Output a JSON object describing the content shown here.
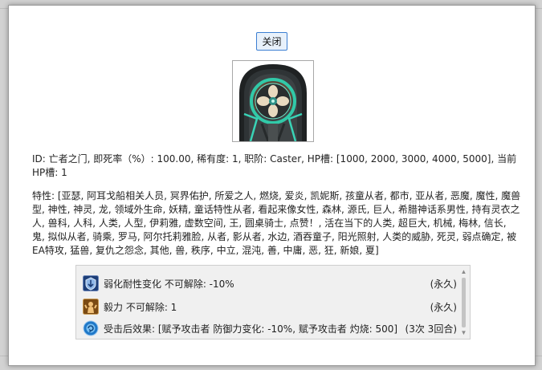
{
  "dialog": {
    "close_label": "关闭",
    "info": "ID: 亡者之门, 即死率（%）: 100.00, 稀有度: 1, 职阶: Caster, HP槽: [1000, 2000, 3000, 4000, 5000], 当前HP槽: 1",
    "traits": "特性: [亚瑟, 阿耳戈船相关人员, 冥界佑护, 所爱之人, 燃烧, 爱炎, 凯妮斯, 孩童从者, 都市, 亚从者, 恶魔, 魔性, 魔兽型, 神性, 神灵, 龙, 领域外生命, 妖精, 童话特性从者, 看起来像女性, 森林, 源氏, 巨人, 希腊神话系男性, 持有灵衣之人, 兽科, 人科, 人类, 人型, 伊莉雅, 虚数空间, 王, 圆桌骑士, 点赞！, 活在当下的人类, 超巨大, 机械, 梅林, 信长, 鬼, 拟似从者, 骑乘, 罗马, 阿尔托莉雅脸, 从者, 影从者, 水边, 酒吞童子, 阳光照射, 人类的威胁, 死灵, 弱点确定, 被EA特攻, 猛兽, 复仇之怨念, 其他, 兽, 秩序, 中立, 混沌, 善, 中庸, 恶, 狂, 新娘, 夏]"
  },
  "buffs": [
    {
      "icon": "debuff-resist-down-icon",
      "text": "弱化耐性变化 不可解除: -10%",
      "duration": "(永久)"
    },
    {
      "icon": "guts-icon",
      "text": "毅力 不可解除: 1",
      "duration": "(永久)"
    },
    {
      "icon": "counter-effect-icon",
      "text": "受击后效果: [赋予攻击者  防御力变化: -10%, 赋予攻击者  灼烧: 500]",
      "duration": "(3次 3回合)"
    }
  ]
}
